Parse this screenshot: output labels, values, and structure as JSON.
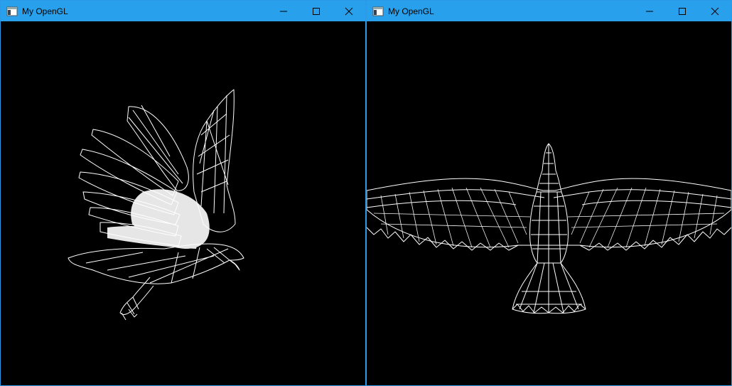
{
  "colors": {
    "titlebar": "#28a0ec",
    "border": "#2b9ae8",
    "viewport_bg": "#000000",
    "wireframe": "#ffffff"
  },
  "windows": [
    {
      "title": "My OpenGL",
      "icons": [
        "window-app-icon",
        "minimize-icon",
        "maximize-icon",
        "close-icon"
      ],
      "content": "eagle-side-wireframe"
    },
    {
      "title": "My OpenGL",
      "icons": [
        "window-app-icon",
        "minimize-icon",
        "maximize-icon",
        "close-icon"
      ],
      "content": "eagle-top-wireframe"
    }
  ]
}
